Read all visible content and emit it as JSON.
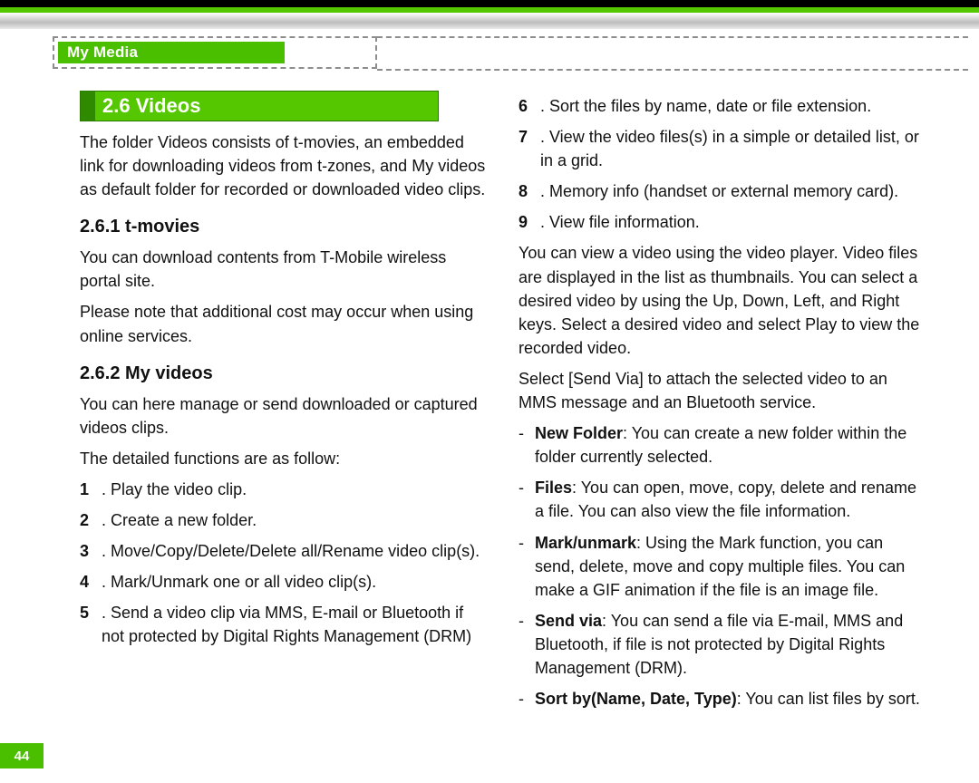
{
  "breadcrumb": "My Media",
  "page_number": "44",
  "section": {
    "title": "2.6 Videos",
    "intro": "The folder Videos consists of t-movies, an embedded link for downloading videos from t-zones, and My videos as default folder for recorded or downloaded video clips."
  },
  "sub1": {
    "title": "2.6.1 t-movies",
    "para1": "You can download contents from T-Mobile wireless portal site.",
    "para2": "Please note that additional cost may occur when using online services."
  },
  "sub2": {
    "title": "2.6.2 My videos",
    "para1": "You can here manage or send downloaded or captured videos clips.",
    "para2": "The detailed functions are as follow:",
    "items": [
      ". Play the video clip.",
      ". Create a new folder.",
      ". Move/Copy/Delete/Delete all/Rename video clip(s).",
      ". Mark/Unmark one or all video clip(s).",
      ". Send a video clip via MMS, E-mail or Bluetooth if not protected by Digital Rights Management (DRM)"
    ]
  },
  "col2": {
    "items": [
      ". Sort the files by name, date or file extension.",
      ". View the video files(s) in a simple or detailed list, or in a grid.",
      ". Memory info (handset or external memory card).",
      ". View file information."
    ],
    "item_nums": [
      "6",
      "7",
      "8",
      "9"
    ],
    "para1": "You can view a video using the video player. Video files are displayed in the list as thumbnails. You can select a desired video by using the Up, Down, Left, and Right keys. Select a desired video and select Play to view the recorded video.",
    "para2": "Select [Send Via] to attach the selected video to an MMS message and an Bluetooth service.",
    "bullets": [
      {
        "label": "New Folder",
        "text": ": You can create a new folder within the folder currently selected."
      },
      {
        "label": "Files",
        "text": ": You can open, move, copy, delete and rename a file. You can also view the file information."
      },
      {
        "label": "Mark/unmark",
        "text": ": Using the Mark function, you can send, delete, move and copy multiple files. You can make a GIF animation if the file is an image file."
      },
      {
        "label": "Send via",
        "text": ": You can send a file via E-mail, MMS and Bluetooth, if file is not protected by Digital Rights Management (DRM)."
      },
      {
        "label": "Sort by(Name, Date, Type)",
        "text": ": You can list files by sort."
      }
    ]
  },
  "nums_left": [
    "1",
    "2",
    "3",
    "4",
    "5"
  ]
}
